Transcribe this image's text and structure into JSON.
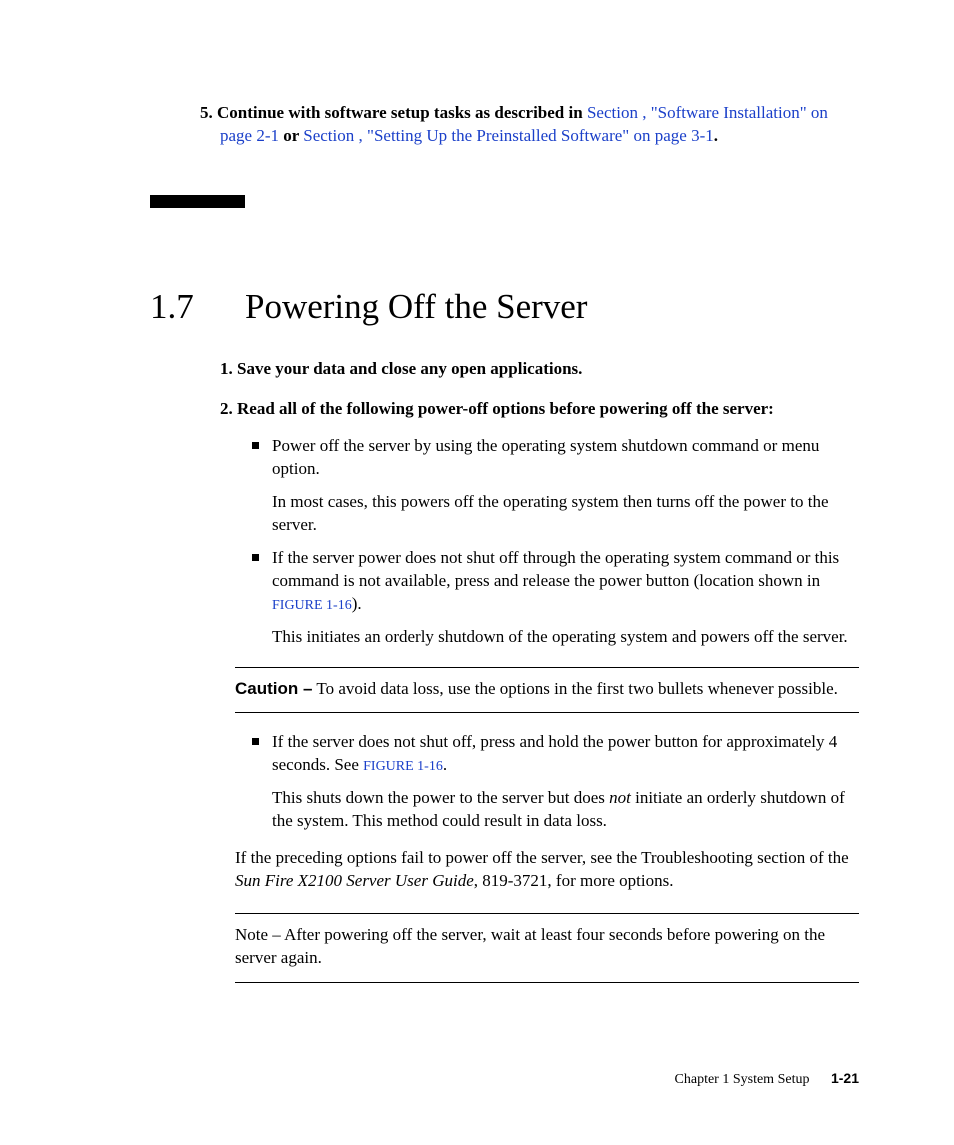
{
  "intro_step": {
    "number": "5.",
    "lead": "Continue with software setup tasks as described in ",
    "link1": "Section , \"Software Installation\" on page 2-1",
    "mid": " or ",
    "link2": "Section , \"Setting Up the Preinstalled Software\" on page 3-1",
    "tail": "."
  },
  "section": {
    "number": "1.7",
    "title": "Powering Off the Server"
  },
  "steps": {
    "s1_num": "1.",
    "s1_text": "Save your data and close any open applications.",
    "s2_num": "2.",
    "s2_text": "Read all of the following power-off options before powering off the server:"
  },
  "bullets_a": {
    "b1_p1": "Power off the server by using the operating system shutdown command or menu option.",
    "b1_p2": "In most cases, this powers off the operating system then turns off the power to the server.",
    "b2_lead": "If the server power does not shut off through the operating system command or this command is not available, press and release the power button (location shown in ",
    "b2_figlink": "FIGURE 1-16",
    "b2_tail": ").",
    "b2_p2": "This initiates an orderly shutdown of the operating system and powers off the server."
  },
  "caution": {
    "label": "Caution –",
    "text": " To avoid data loss, use the options in the first two bullets whenever possible."
  },
  "bullets_b": {
    "b3_lead": "If the server does not shut off, press and hold the power button for approximately 4 seconds. See ",
    "b3_figlink": "FIGURE 1-16",
    "b3_tail": ".",
    "b3_p2a": "This shuts down the power to the server but does ",
    "b3_p2_not": "not",
    "b3_p2b": " initiate an orderly shutdown of the system. This method could result in data loss."
  },
  "trail": {
    "pre": "If the preceding options fail to power off the server, see the Troubleshooting section of the ",
    "ital": "Sun Fire X2100 Server User Guide",
    "post": ", 819-3721, for more options."
  },
  "note": {
    "label": "Note –",
    "text": " After powering off the server, wait at least four seconds before powering on the server again."
  },
  "footer": {
    "chapter": "Chapter 1   System Setup",
    "page": "1-21"
  }
}
